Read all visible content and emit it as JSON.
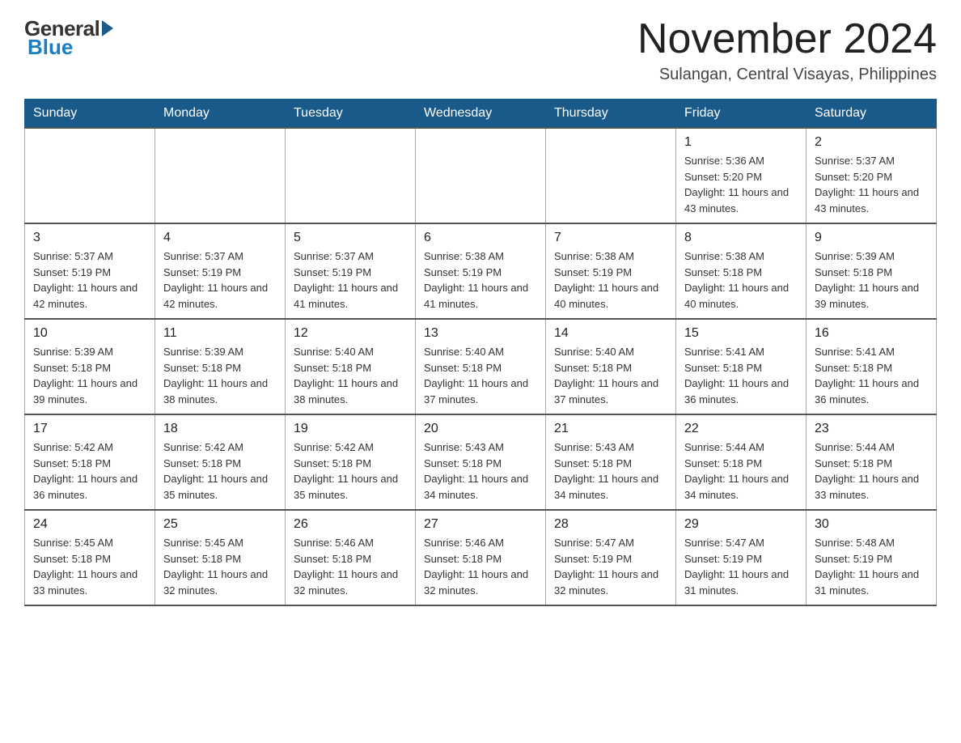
{
  "logo": {
    "general": "General",
    "blue": "Blue"
  },
  "header": {
    "month": "November 2024",
    "location": "Sulangan, Central Visayas, Philippines"
  },
  "days_of_week": [
    "Sunday",
    "Monday",
    "Tuesday",
    "Wednesday",
    "Thursday",
    "Friday",
    "Saturday"
  ],
  "weeks": [
    [
      {
        "day": "",
        "info": ""
      },
      {
        "day": "",
        "info": ""
      },
      {
        "day": "",
        "info": ""
      },
      {
        "day": "",
        "info": ""
      },
      {
        "day": "",
        "info": ""
      },
      {
        "day": "1",
        "info": "Sunrise: 5:36 AM\nSunset: 5:20 PM\nDaylight: 11 hours and 43 minutes."
      },
      {
        "day": "2",
        "info": "Sunrise: 5:37 AM\nSunset: 5:20 PM\nDaylight: 11 hours and 43 minutes."
      }
    ],
    [
      {
        "day": "3",
        "info": "Sunrise: 5:37 AM\nSunset: 5:19 PM\nDaylight: 11 hours and 42 minutes."
      },
      {
        "day": "4",
        "info": "Sunrise: 5:37 AM\nSunset: 5:19 PM\nDaylight: 11 hours and 42 minutes."
      },
      {
        "day": "5",
        "info": "Sunrise: 5:37 AM\nSunset: 5:19 PM\nDaylight: 11 hours and 41 minutes."
      },
      {
        "day": "6",
        "info": "Sunrise: 5:38 AM\nSunset: 5:19 PM\nDaylight: 11 hours and 41 minutes."
      },
      {
        "day": "7",
        "info": "Sunrise: 5:38 AM\nSunset: 5:19 PM\nDaylight: 11 hours and 40 minutes."
      },
      {
        "day": "8",
        "info": "Sunrise: 5:38 AM\nSunset: 5:18 PM\nDaylight: 11 hours and 40 minutes."
      },
      {
        "day": "9",
        "info": "Sunrise: 5:39 AM\nSunset: 5:18 PM\nDaylight: 11 hours and 39 minutes."
      }
    ],
    [
      {
        "day": "10",
        "info": "Sunrise: 5:39 AM\nSunset: 5:18 PM\nDaylight: 11 hours and 39 minutes."
      },
      {
        "day": "11",
        "info": "Sunrise: 5:39 AM\nSunset: 5:18 PM\nDaylight: 11 hours and 38 minutes."
      },
      {
        "day": "12",
        "info": "Sunrise: 5:40 AM\nSunset: 5:18 PM\nDaylight: 11 hours and 38 minutes."
      },
      {
        "day": "13",
        "info": "Sunrise: 5:40 AM\nSunset: 5:18 PM\nDaylight: 11 hours and 37 minutes."
      },
      {
        "day": "14",
        "info": "Sunrise: 5:40 AM\nSunset: 5:18 PM\nDaylight: 11 hours and 37 minutes."
      },
      {
        "day": "15",
        "info": "Sunrise: 5:41 AM\nSunset: 5:18 PM\nDaylight: 11 hours and 36 minutes."
      },
      {
        "day": "16",
        "info": "Sunrise: 5:41 AM\nSunset: 5:18 PM\nDaylight: 11 hours and 36 minutes."
      }
    ],
    [
      {
        "day": "17",
        "info": "Sunrise: 5:42 AM\nSunset: 5:18 PM\nDaylight: 11 hours and 36 minutes."
      },
      {
        "day": "18",
        "info": "Sunrise: 5:42 AM\nSunset: 5:18 PM\nDaylight: 11 hours and 35 minutes."
      },
      {
        "day": "19",
        "info": "Sunrise: 5:42 AM\nSunset: 5:18 PM\nDaylight: 11 hours and 35 minutes."
      },
      {
        "day": "20",
        "info": "Sunrise: 5:43 AM\nSunset: 5:18 PM\nDaylight: 11 hours and 34 minutes."
      },
      {
        "day": "21",
        "info": "Sunrise: 5:43 AM\nSunset: 5:18 PM\nDaylight: 11 hours and 34 minutes."
      },
      {
        "day": "22",
        "info": "Sunrise: 5:44 AM\nSunset: 5:18 PM\nDaylight: 11 hours and 34 minutes."
      },
      {
        "day": "23",
        "info": "Sunrise: 5:44 AM\nSunset: 5:18 PM\nDaylight: 11 hours and 33 minutes."
      }
    ],
    [
      {
        "day": "24",
        "info": "Sunrise: 5:45 AM\nSunset: 5:18 PM\nDaylight: 11 hours and 33 minutes."
      },
      {
        "day": "25",
        "info": "Sunrise: 5:45 AM\nSunset: 5:18 PM\nDaylight: 11 hours and 32 minutes."
      },
      {
        "day": "26",
        "info": "Sunrise: 5:46 AM\nSunset: 5:18 PM\nDaylight: 11 hours and 32 minutes."
      },
      {
        "day": "27",
        "info": "Sunrise: 5:46 AM\nSunset: 5:18 PM\nDaylight: 11 hours and 32 minutes."
      },
      {
        "day": "28",
        "info": "Sunrise: 5:47 AM\nSunset: 5:19 PM\nDaylight: 11 hours and 32 minutes."
      },
      {
        "day": "29",
        "info": "Sunrise: 5:47 AM\nSunset: 5:19 PM\nDaylight: 11 hours and 31 minutes."
      },
      {
        "day": "30",
        "info": "Sunrise: 5:48 AM\nSunset: 5:19 PM\nDaylight: 11 hours and 31 minutes."
      }
    ]
  ]
}
